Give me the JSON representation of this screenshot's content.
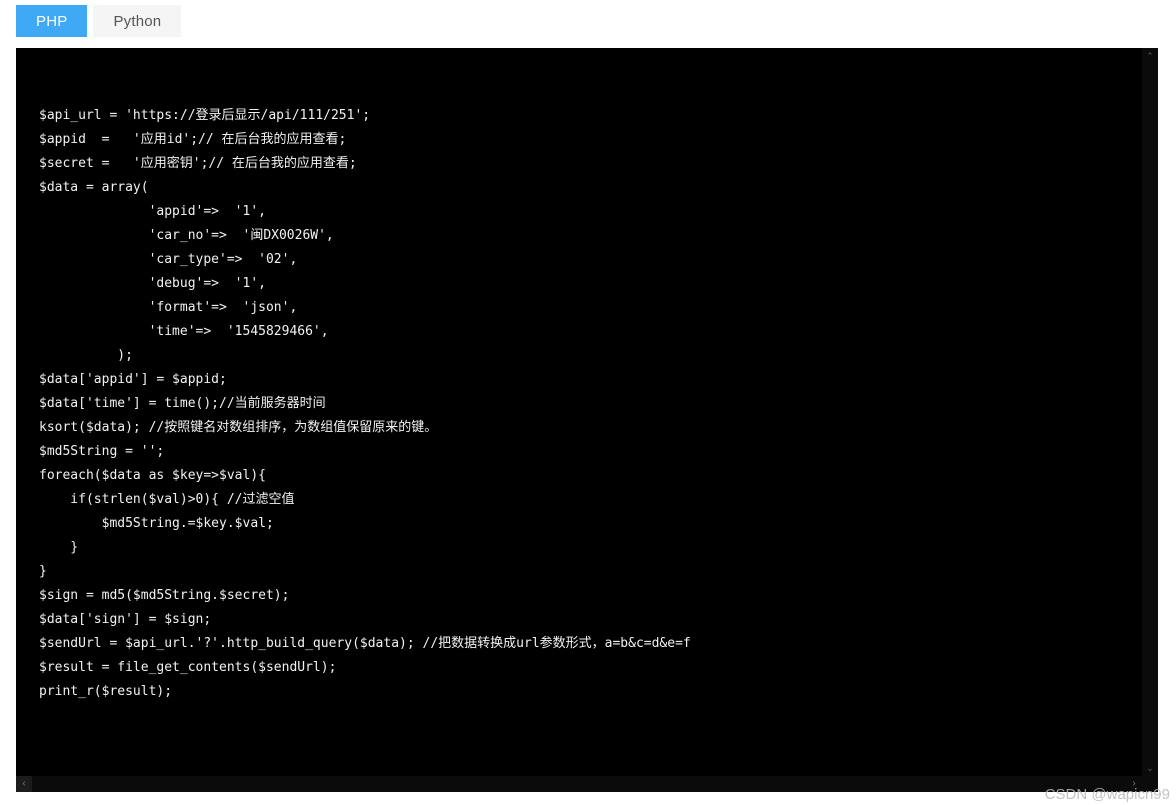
{
  "tabs": [
    {
      "label": "PHP",
      "active": true
    },
    {
      "label": "Python",
      "active": false
    }
  ],
  "colors": {
    "tab_active_bg": "#3fa9f5",
    "tab_active_text": "#ffffff",
    "tab_inactive_bg": "#f5f5f5",
    "tab_inactive_text": "#555555",
    "code_bg": "#000000",
    "code_text": "#f2f2f2",
    "scrollbar_bg": "#0b0b0b",
    "page_bg": "#ffffff"
  },
  "code": {
    "language": "PHP",
    "lines": [
      "$api_url = 'https://登录后显示/api/111/251';",
      "$appid  =   '应用id';// 在后台我的应用查看;",
      "$secret =   '应用密钥';// 在后台我的应用查看;",
      "$data = array(",
      "              'appid'=>  '1',",
      "              'car_no'=>  '闽DX0026W',",
      "              'car_type'=>  '02',",
      "              'debug'=>  '1',",
      "              'format'=>  'json',",
      "              'time'=>  '1545829466',",
      "          );",
      "$data['appid'] = $appid;",
      "$data['time'] = time();//当前服务器时间",
      "ksort($data); //按照键名对数组排序，为数组值保留原来的键。",
      "$md5String = '';",
      "foreach($data as $key=>$val){",
      "    if(strlen($val)>0){ //过滤空值",
      "        $md5String.=$key.$val;",
      "    }",
      "}",
      "$sign = md5($md5String.$secret);",
      "$data['sign'] = $sign;",
      "$sendUrl = $api_url.'?'.http_build_query($data); //把数据转换成url参数形式，a=b&c=d&e=f",
      "$result = file_get_contents($sendUrl);",
      "print_r($result);"
    ]
  },
  "scrollbars": {
    "vertical": {
      "up_glyph": "⌃",
      "down_glyph": "⌄"
    },
    "horizontal": {
      "left_glyph": "‹",
      "right_glyph": "›"
    }
  },
  "watermark": {
    "text": "CSDN @wapicn99"
  }
}
